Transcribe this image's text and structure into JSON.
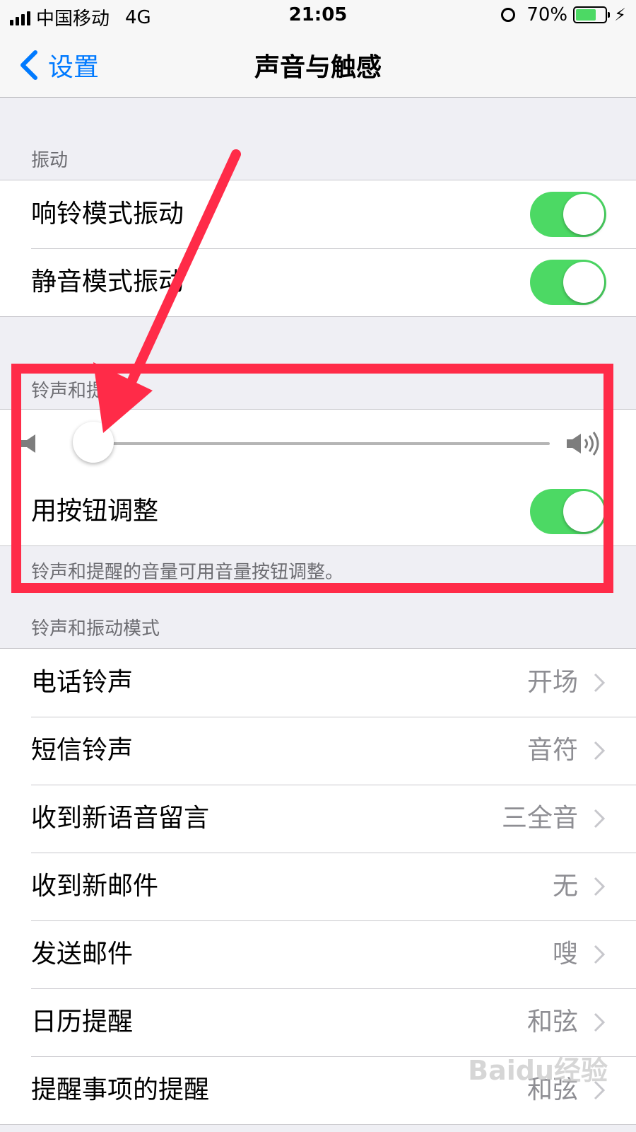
{
  "status_bar": {
    "carrier": "中国移动",
    "network": "4G",
    "time": "21:05",
    "battery": "70%",
    "battery_level": 0.7
  },
  "nav": {
    "back_label": "设置",
    "title": "声音与触感"
  },
  "vibration": {
    "header": "振动",
    "items": [
      {
        "label": "响铃模式振动",
        "on": true
      },
      {
        "label": "静音模式振动",
        "on": true
      }
    ]
  },
  "ringer": {
    "header": "铃声和提醒",
    "volume_level": 0.0,
    "adjust_label": "用按钮调整",
    "adjust_on": true,
    "footer": "铃声和提醒的音量可用音量按钮调整。"
  },
  "patterns": {
    "header": "铃声和振动模式",
    "items": [
      {
        "label": "电话铃声",
        "value": "开场"
      },
      {
        "label": "短信铃声",
        "value": "音符"
      },
      {
        "label": "收到新语音留言",
        "value": "三全音"
      },
      {
        "label": "收到新邮件",
        "value": "无"
      },
      {
        "label": "发送邮件",
        "value": "嗖"
      },
      {
        "label": "日历提醒",
        "value": "和弦"
      },
      {
        "label": "提醒事项的提醒",
        "value": "和弦"
      }
    ]
  },
  "colors": {
    "accent": "#007aff",
    "toggle_on": "#4cd964",
    "annotation": "#ff2b48"
  },
  "watermark": "Baidu经验"
}
